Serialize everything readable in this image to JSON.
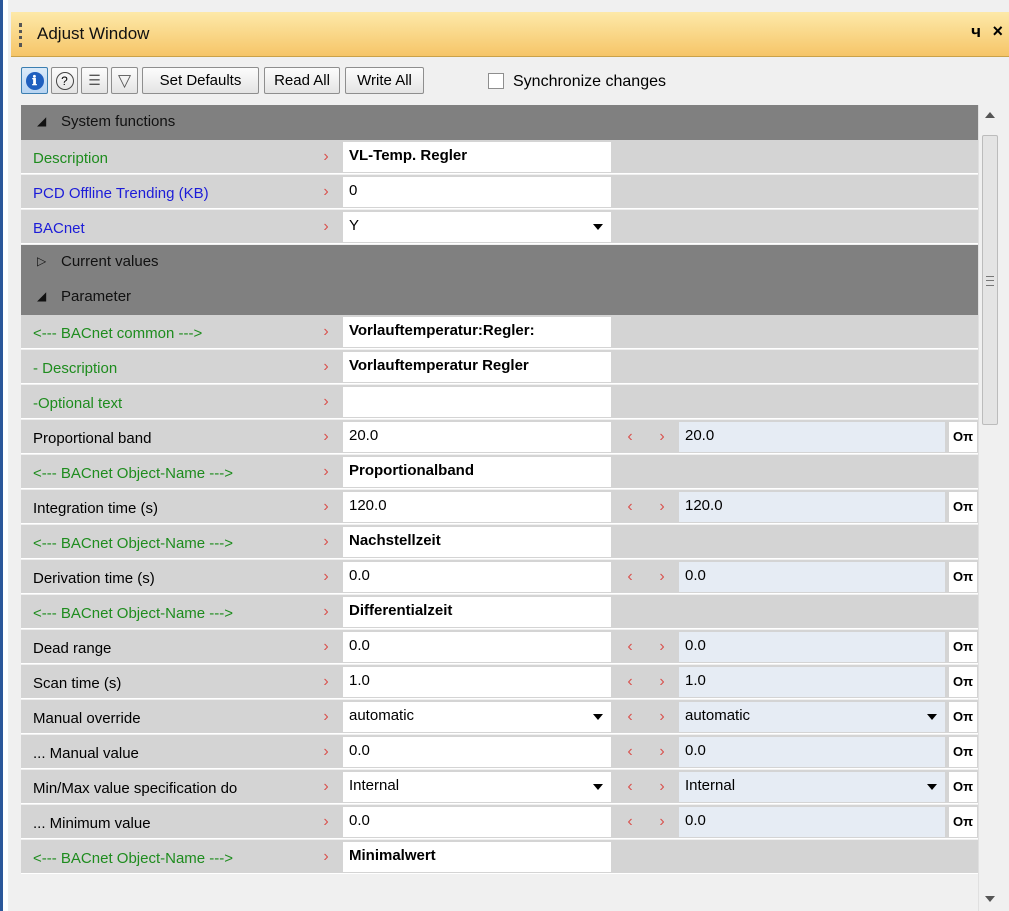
{
  "window": {
    "title": "Adjust Window",
    "pin_glyph": "ч",
    "close_glyph": "×"
  },
  "toolbar": {
    "icons": [
      {
        "name": "info-icon",
        "glyph": "ℹ"
      },
      {
        "name": "help-icon",
        "glyph": "?"
      },
      {
        "name": "list-icon",
        "glyph": "☰"
      },
      {
        "name": "filter-icon",
        "glyph": "▽"
      }
    ],
    "set_defaults": "Set Defaults",
    "read_all": "Read All",
    "write_all": "Write All",
    "sync_label": "Synchronize changes"
  },
  "colors": {
    "title_gradient_top": "#fde9a9",
    "title_gradient_bottom": "#f6c568",
    "category_bg": "#808080",
    "label_bg": "#d4d4d4",
    "green_label": "#1e8c1e",
    "blue_label": "#1c1cd8",
    "arrow_red": "#d9534f",
    "value2_bg": "#e6ecf4"
  },
  "rows": [
    {
      "type": "category",
      "expanded": true,
      "text": "System functions"
    },
    {
      "type": "prop",
      "label": "Description",
      "color": "green",
      "v1": "VL-Temp. Regler",
      "bold": true
    },
    {
      "type": "prop",
      "label": "PCD Offline Trending (KB)",
      "color": "blue",
      "v1": "0"
    },
    {
      "type": "prop",
      "label": "BACnet",
      "color": "blue",
      "v1": "Y",
      "dd1": true
    },
    {
      "type": "category",
      "expanded": false,
      "text": "Current values"
    },
    {
      "type": "category",
      "expanded": true,
      "text": "Parameter"
    },
    {
      "type": "prop",
      "label": "<--- BACnet common --->",
      "color": "green",
      "v1": "Vorlauftemperatur:Regler:",
      "bold": true
    },
    {
      "type": "prop",
      "label": "- Description",
      "color": "green",
      "v1": "Vorlauftemperatur Regler",
      "bold": true
    },
    {
      "type": "prop",
      "label": "-Optional text",
      "color": "green",
      "v1": ""
    },
    {
      "type": "prop",
      "label": "Proportional band",
      "color": "black",
      "v1": "20.0",
      "v2": "20.0"
    },
    {
      "type": "prop",
      "label": "<--- BACnet Object-Name --->",
      "color": "green",
      "v1": "Proportionalband",
      "bold": true,
      "nofield": true
    },
    {
      "type": "prop",
      "label": "Integration time (s)",
      "color": "black",
      "v1": "120.0",
      "v2": "120.0"
    },
    {
      "type": "prop",
      "label": "<--- BACnet Object-Name --->",
      "color": "green",
      "v1": "Nachstellzeit",
      "bold": true,
      "nofield": true
    },
    {
      "type": "prop",
      "label": "Derivation time (s)",
      "color": "black",
      "v1": "0.0",
      "v2": "0.0"
    },
    {
      "type": "prop",
      "label": "<--- BACnet Object-Name --->",
      "color": "green",
      "v1": "Differentialzeit",
      "bold": true,
      "nofield": true
    },
    {
      "type": "prop",
      "label": "Dead range",
      "color": "black",
      "v1": "0.0",
      "v2": "0.0"
    },
    {
      "type": "prop",
      "label": "Scan time (s)",
      "color": "black",
      "v1": "1.0",
      "v2": "1.0"
    },
    {
      "type": "prop",
      "label": "Manual override",
      "color": "black",
      "v1": "automatic",
      "v2": "automatic",
      "dd1": true,
      "dd2": true
    },
    {
      "type": "prop",
      "label": "... Manual value",
      "color": "black",
      "v1": "0.0",
      "v2": "0.0"
    },
    {
      "type": "prop",
      "label": "Min/Max value specification do",
      "color": "black",
      "v1": "Internal",
      "v2": "Internal",
      "dd1": true,
      "dd2": true
    },
    {
      "type": "prop",
      "label": "... Minimum value",
      "color": "black",
      "v1": "0.0",
      "v2": "0.0"
    },
    {
      "type": "prop",
      "label": "<--- BACnet Object-Name --->",
      "color": "green",
      "v1": "Minimalwert",
      "bold": true,
      "nofield": true
    }
  ]
}
